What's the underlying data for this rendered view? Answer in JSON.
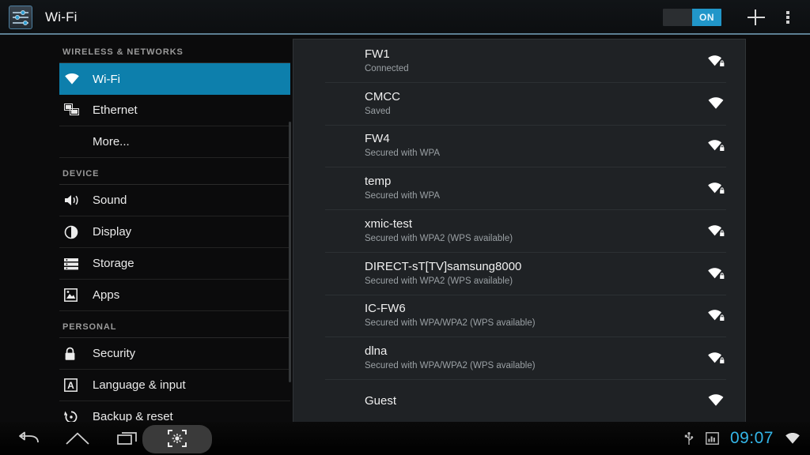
{
  "actionbar": {
    "app_icon": "settings-sliders-icon",
    "title": "Wi-Fi",
    "toggle_label": "ON",
    "toggle_state": "on",
    "add_icon": "plus-icon",
    "overflow_icon": "overflow-menu-icon",
    "accent_color": "#2196c9"
  },
  "sidebar": {
    "sections": [
      {
        "header": "WIRELESS & NETWORKS",
        "items": [
          {
            "label": "Wi-Fi",
            "icon": "wifi-icon",
            "selected": true
          },
          {
            "label": "Ethernet",
            "icon": "ethernet-icon",
            "selected": false
          },
          {
            "label": "More...",
            "icon": "",
            "selected": false
          }
        ]
      },
      {
        "header": "DEVICE",
        "items": [
          {
            "label": "Sound",
            "icon": "speaker-icon",
            "selected": false
          },
          {
            "label": "Display",
            "icon": "brightness-icon",
            "selected": false
          },
          {
            "label": "Storage",
            "icon": "storage-icon",
            "selected": false
          },
          {
            "label": "Apps",
            "icon": "apps-image-icon",
            "selected": false
          }
        ]
      },
      {
        "header": "PERSONAL",
        "items": [
          {
            "label": "Security",
            "icon": "lock-icon",
            "selected": false
          },
          {
            "label": "Language & input",
            "icon": "language-a-icon",
            "selected": false
          },
          {
            "label": "Backup & reset",
            "icon": "backup-restore-icon",
            "selected": false
          }
        ]
      }
    ],
    "selected_color": "#0d7fac"
  },
  "wifi_list": [
    {
      "ssid": "FW1",
      "status": "Connected",
      "secured": true,
      "icon": "wifi-signal-icon"
    },
    {
      "ssid": "CMCC",
      "status": "Saved",
      "secured": false,
      "icon": "wifi-signal-icon"
    },
    {
      "ssid": "FW4",
      "status": "Secured with WPA",
      "secured": true,
      "icon": "wifi-signal-icon"
    },
    {
      "ssid": "temp",
      "status": "Secured with WPA",
      "secured": true,
      "icon": "wifi-signal-icon"
    },
    {
      "ssid": "xmic-test",
      "status": "Secured with WPA2 (WPS available)",
      "secured": true,
      "icon": "wifi-signal-icon"
    },
    {
      "ssid": "DIRECT-sT[TV]samsung8000",
      "status": "Secured with WPA2 (WPS available)",
      "secured": true,
      "icon": "wifi-signal-icon"
    },
    {
      "ssid": "IC-FW6",
      "status": "Secured with WPA/WPA2 (WPS available)",
      "secured": true,
      "icon": "wifi-signal-icon"
    },
    {
      "ssid": "dlna",
      "status": "Secured with WPA/WPA2 (WPS available)",
      "secured": true,
      "icon": "wifi-signal-icon"
    },
    {
      "ssid": "Guest",
      "status": "",
      "secured": false,
      "icon": "wifi-signal-icon"
    }
  ],
  "navbar": {
    "back_icon": "back-arrow-icon",
    "home_icon": "home-icon",
    "recents_icon": "recent-apps-icon",
    "screenshot_icon": "screenshot-capture-icon"
  },
  "statusbar": {
    "usb_icon": "usb-icon",
    "screenshot_icon": "image-icon",
    "clock": "09:07",
    "wifi_icon": "wifi-status-icon",
    "clock_color": "#34b6e8"
  }
}
